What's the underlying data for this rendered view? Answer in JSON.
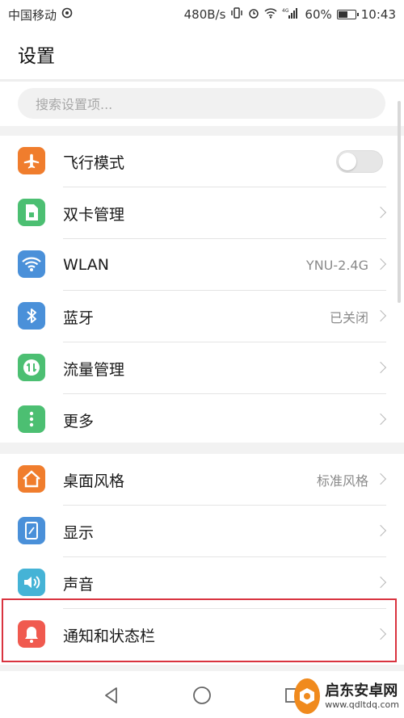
{
  "status_bar": {
    "carrier": "中国移动",
    "speed": "480B/s",
    "network": "4G",
    "battery": "60%",
    "battery_level": 0.6,
    "time": "10:43"
  },
  "header": {
    "title": "设置"
  },
  "search": {
    "placeholder": "搜索设置项..."
  },
  "section1": [
    {
      "label": "飞行模式",
      "icon": "airplane-icon",
      "color": "#f07d2d",
      "toggle": false
    },
    {
      "label": "双卡管理",
      "icon": "sim-card-icon",
      "color": "#4cbf72"
    },
    {
      "label": "WLAN",
      "icon": "wifi-icon",
      "color": "#4a90d9",
      "value": "YNU-2.4G"
    },
    {
      "label": "蓝牙",
      "icon": "bluetooth-icon",
      "color": "#4a90d9",
      "value": "已关闭"
    },
    {
      "label": "流量管理",
      "icon": "data-usage-icon",
      "color": "#4cbf72"
    },
    {
      "label": "更多",
      "icon": "more-icon",
      "color": "#4cbf72"
    }
  ],
  "section2": [
    {
      "label": "桌面风格",
      "icon": "home-icon",
      "color": "#f07d2d",
      "value": "标准风格"
    },
    {
      "label": "显示",
      "icon": "display-icon",
      "color": "#4a90d9"
    },
    {
      "label": "声音",
      "icon": "sound-icon",
      "color": "#45b3d6"
    },
    {
      "label": "通知和状态栏",
      "icon": "bell-icon",
      "color": "#f05a4f"
    }
  ],
  "watermark": {
    "name": "启东安卓网",
    "url": "www.qdltdq.com"
  }
}
